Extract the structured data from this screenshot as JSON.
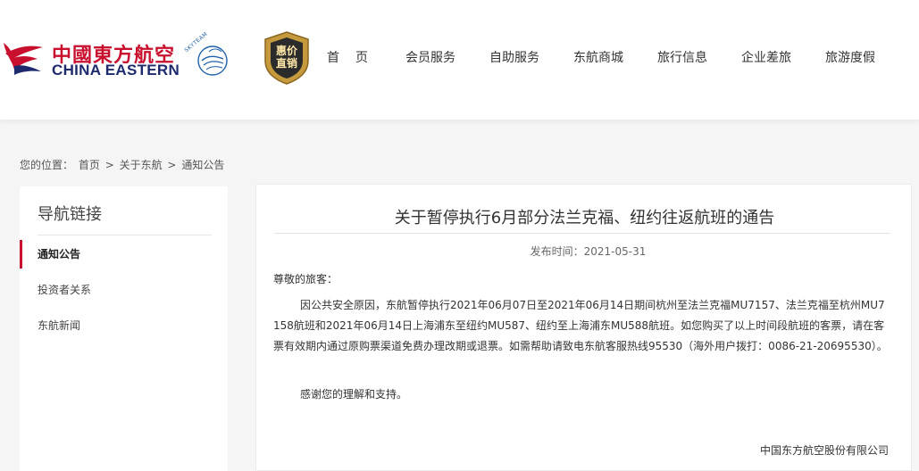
{
  "header": {
    "logo_cn": "中國東方航空",
    "logo_en": "CHINA EASTERN",
    "skyteam_label": "SKYTEAM",
    "badge_line1": "惠价",
    "badge_line2": "直销",
    "nav": [
      "首页",
      "会员服务",
      "自助服务",
      "东航商城",
      "旅行信息",
      "企业差旅",
      "旅游度假"
    ]
  },
  "breadcrumb": {
    "prefix": "您的位置：",
    "items": [
      "首页",
      "关于东航",
      "通知公告"
    ],
    "separator": ">"
  },
  "sidebar": {
    "title": "导航链接",
    "items": [
      "通知公告",
      "投资者关系",
      "东航新闻"
    ],
    "active_index": 0
  },
  "article": {
    "title": "关于暂停执行6月部分法兰克福、纽约往返航班的通告",
    "publish_label": "发布时间：",
    "publish_date": "2021-05-31",
    "greeting": "尊敬的旅客：",
    "body": "因公共安全原因，东航暂停执行2021年06月07日至2021年06月14日期间杭州至法兰克福MU7157、法兰克福至杭州MU7158航班和2021年06月14日上海浦东至纽约MU587、纽约至上海浦东MU588航班。如您购买了以上时间段航班的客票，请在客票有效期内通过原购票渠道免费办理改期或退票。如需帮助请致电东航客服热线95530（海外用户拨打：0086-21-20695530）。",
    "thanks": "感谢您的理解和支持。",
    "signature": "中国东方航空股份有限公司"
  },
  "colors": {
    "brand_red": "#c8102e",
    "brand_navy": "#1d2a6e",
    "badge_gold": "#c59a3c"
  }
}
